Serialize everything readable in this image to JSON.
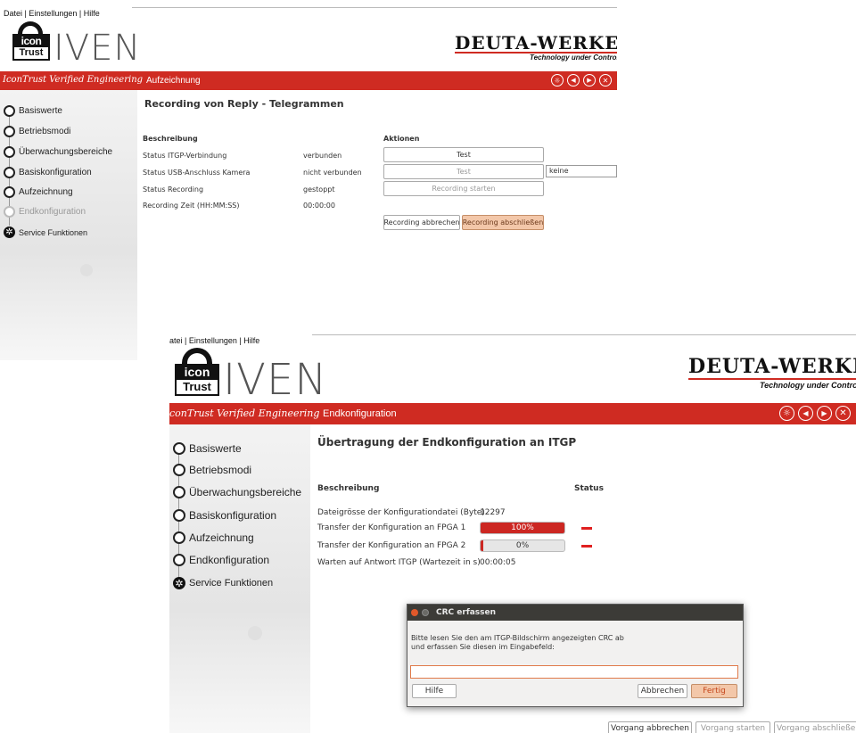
{
  "window1": {
    "menu": "Datei | Einstellungen | Hilfe",
    "logo": {
      "icon_line1": "ICON",
      "icon_line2": "Trust",
      "product": "IVEN",
      "tagline": "IconTrust Verified Engineering"
    },
    "brand": {
      "name": "DEUTA-WERKE",
      "subtitle": "Technology under Control"
    },
    "section": "Aufzeichnung",
    "sidebar": [
      {
        "label": "Basiswerte",
        "icon": "radio-filled-icon"
      },
      {
        "label": "Betriebsmodi",
        "icon": "radio-filled-icon"
      },
      {
        "label": "Überwachungsbereiche",
        "icon": "radio-filled-icon"
      },
      {
        "label": "Basiskonfiguration",
        "icon": "radio-filled-icon"
      },
      {
        "label": "Aufzeichnung",
        "icon": "radio-filled-icon"
      },
      {
        "label": "Endkonfiguration",
        "icon": "radio-empty-icon"
      },
      {
        "label": "Service Funktionen",
        "icon": "gear-icon"
      }
    ],
    "title": "Recording von Reply - Telegrammen",
    "col_desc": "Beschreibung",
    "col_actions": "Aktionen",
    "rows": [
      {
        "label": "Status ITGP-Verbindung",
        "value": "verbunden"
      },
      {
        "label": "Status USB-Anschluss Kamera",
        "value": "nicht verbunden"
      },
      {
        "label": "Status Recording",
        "value": "gestoppt"
      },
      {
        "label": "Recording Zeit (HH:MM:SS)",
        "value": "00:00:00"
      }
    ],
    "actions": {
      "test1": "Test",
      "test2": "Test",
      "camera_select": "keine",
      "start": "Recording starten",
      "abort": "Recording abbrechen",
      "finish": "Recording abschließen"
    }
  },
  "window2": {
    "menu": "atei | Einstellungen | Hilfe",
    "logo": {
      "icon_line1": "ICON",
      "icon_line2": "Trust",
      "product": "IVEN",
      "tagline": "conTrust Verified Engineering"
    },
    "brand": {
      "name": "DEUTA-WERKE",
      "subtitle": "Technology under Control"
    },
    "section": "Endkonfiguration",
    "sidebar": [
      {
        "label": "Basiswerte",
        "icon": "radio-filled-icon"
      },
      {
        "label": "Betriebsmodi",
        "icon": "radio-filled-icon"
      },
      {
        "label": "Überwachungsbereiche",
        "icon": "radio-filled-icon"
      },
      {
        "label": "Basiskonfiguration",
        "icon": "radio-filled-icon"
      },
      {
        "label": "Aufzeichnung",
        "icon": "radio-filled-icon"
      },
      {
        "label": "Endkonfiguration",
        "icon": "radio-filled-icon"
      },
      {
        "label": "Service Funktionen",
        "icon": "gear-icon"
      }
    ],
    "title": "Übertragung der Endkonfiguration an ITGP",
    "col_desc": "Beschreibung",
    "col_status": "Status",
    "rows": [
      {
        "label": "Dateigrösse der Konfigurationdatei (Byte)",
        "value": "12297"
      },
      {
        "label": "Transfer der Konfiguration an FPGA 1",
        "progress": 1.0,
        "progress_text": "100%"
      },
      {
        "label": "Transfer der Konfiguration an FPGA 2",
        "progress": 0.0,
        "progress_text": "0%"
      },
      {
        "label": "Warten auf Antwort ITGP (Wartezeit in s)",
        "value": "00:00:05"
      }
    ],
    "buttons": {
      "abort": "Vorgang abbrechen",
      "start": "Vorgang starten",
      "finish": "Vorgang abschließen"
    },
    "dialog": {
      "title": "CRC erfassen",
      "message_line1": "Bitte lesen Sie den am ITGP-Bildschirm angezeigten CRC ab",
      "message_line2": "und erfassen Sie diesen im Eingabefeld:",
      "input_value": "",
      "help": "Hilfe",
      "cancel": "Abbrechen",
      "done": "Fertig"
    }
  },
  "colors": {
    "red_bar": "#cf2b22",
    "progress_red": "#cc2722",
    "dialog_title_bg": "#3c3b37"
  }
}
